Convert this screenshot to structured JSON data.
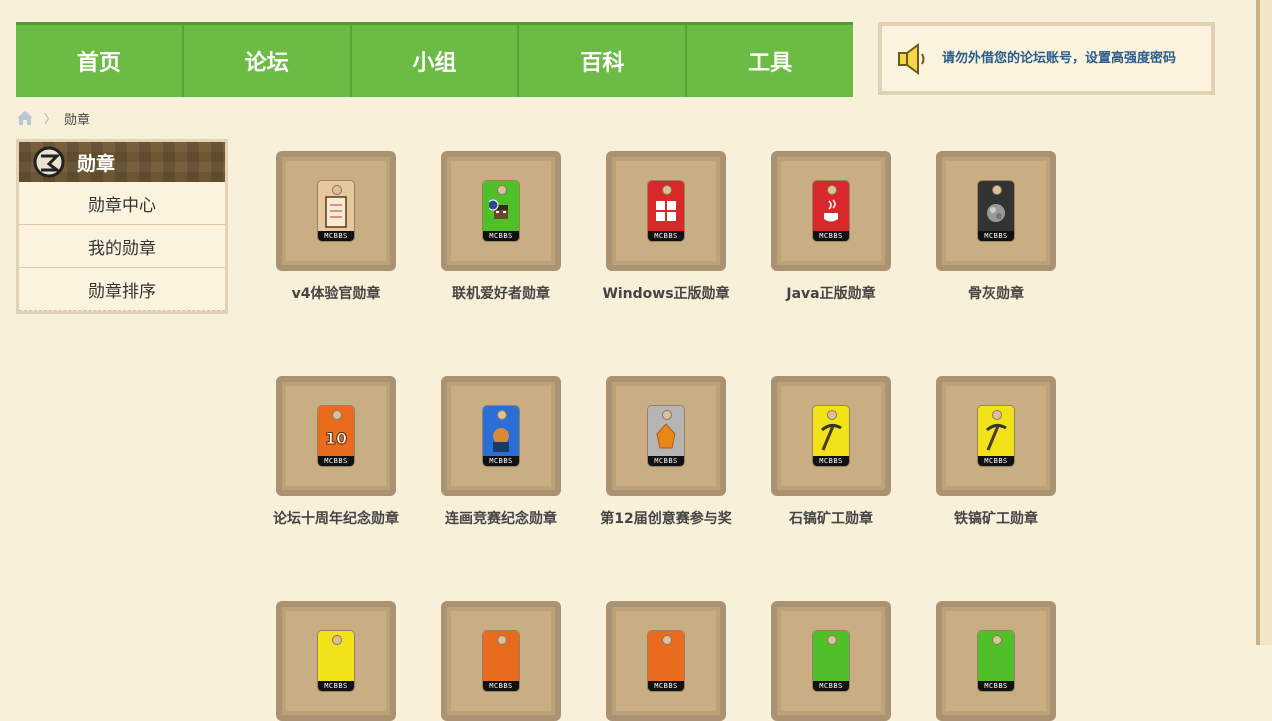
{
  "nav": {
    "items": [
      {
        "label": "首页"
      },
      {
        "label": "论坛"
      },
      {
        "label": "小组"
      },
      {
        "label": "百科"
      },
      {
        "label": "工具"
      }
    ]
  },
  "notice": {
    "icon": "speaker-icon",
    "text": "请勿外借您的论坛账号，设置高强度密码"
  },
  "breadcrumb": {
    "home_icon": "home-icon",
    "separator": "〉",
    "current": "勋章"
  },
  "sidebar": {
    "title": "勋章",
    "items": [
      {
        "label": "勋章中心"
      },
      {
        "label": "我的勋章"
      },
      {
        "label": "勋章排序"
      }
    ]
  },
  "medal_tag_text": "MCBBS",
  "medals": [
    {
      "name": "v4体验官勋章",
      "color": "#e8c89a",
      "icon": "clipboard-icon"
    },
    {
      "name": "联机爱好者勋章",
      "color": "#4fbf2a",
      "icon": "steve-head-icon"
    },
    {
      "name": "Windows正版勋章",
      "color": "#d8282a",
      "icon": "windows-logo-icon"
    },
    {
      "name": "Java正版勋章",
      "color": "#d8282a",
      "icon": "java-cup-icon"
    },
    {
      "name": "骨灰勋章",
      "color": "#333333",
      "icon": "ash-icon"
    },
    {
      "name": "论坛十周年纪念勋章",
      "color": "#e86b1e",
      "icon": "number-10-icon"
    },
    {
      "name": "连画竞赛纪念勋章",
      "color": "#2a6fd8",
      "icon": "portrait-icon"
    },
    {
      "name": "第12届创意赛参与奖",
      "color": "#b5b5b5",
      "icon": "amber-crystal-icon"
    },
    {
      "name": "石镐矿工勋章",
      "color": "#f2e21a",
      "icon": "stone-pickaxe-icon"
    },
    {
      "name": "铁镐矿工勋章",
      "color": "#f2e21a",
      "icon": "iron-pickaxe-icon"
    },
    {
      "name": "",
      "color": "#f2e21a",
      "icon": "medal-icon"
    },
    {
      "name": "",
      "color": "#e86b1e",
      "icon": "medal-icon"
    },
    {
      "name": "",
      "color": "#e86b1e",
      "icon": "medal-icon"
    },
    {
      "name": "",
      "color": "#4fbf2a",
      "icon": "medal-icon"
    },
    {
      "name": "",
      "color": "#4fbf2a",
      "icon": "medal-icon"
    }
  ],
  "colors": {
    "nav_green": "#6bbb45",
    "background": "#f9f0da",
    "notice_text": "#2b5d8a"
  }
}
